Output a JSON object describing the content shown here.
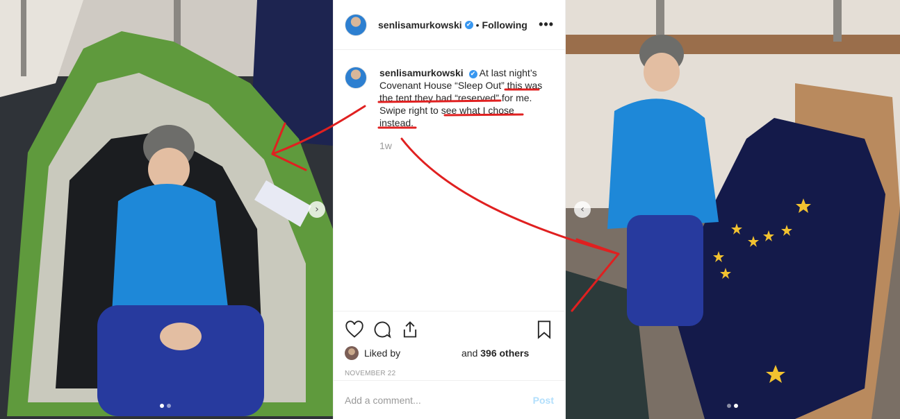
{
  "post": {
    "header": {
      "username": "senlisamurkowski",
      "verified_glyph": "✔",
      "separator": "•",
      "following": "Following",
      "more": "•••"
    },
    "caption": {
      "username": "senlisamurkowski",
      "text": "At last night’s Covenant House “Sleep Out” this was the tent they had “reserved” for me. Swipe right to see what I chose instead.",
      "time": "1w"
    },
    "actions": {
      "like_icon": "heart-icon",
      "comment_icon": "comment-icon",
      "share_icon": "share-icon",
      "save_icon": "bookmark-icon"
    },
    "likes": {
      "liked_by": "Liked by",
      "and": "and",
      "count": "396 others"
    },
    "date": "NOVEMBER 22",
    "comment": {
      "placeholder": "Add a comment...",
      "post_label": "Post"
    }
  },
  "carousel_left": {
    "next_glyph": "›",
    "dots": 2,
    "active_dot": 0
  },
  "carousel_right": {
    "prev_glyph": "‹",
    "dots": 2,
    "active_dot": 1
  },
  "colors": {
    "annotation_red": "#e02020",
    "verified_blue": "#3897f0",
    "jacket_blue": "#1e88d8",
    "tent_green": "#5b8c3a",
    "flag_navy": "#141a4a",
    "flag_star": "#f2c230"
  }
}
